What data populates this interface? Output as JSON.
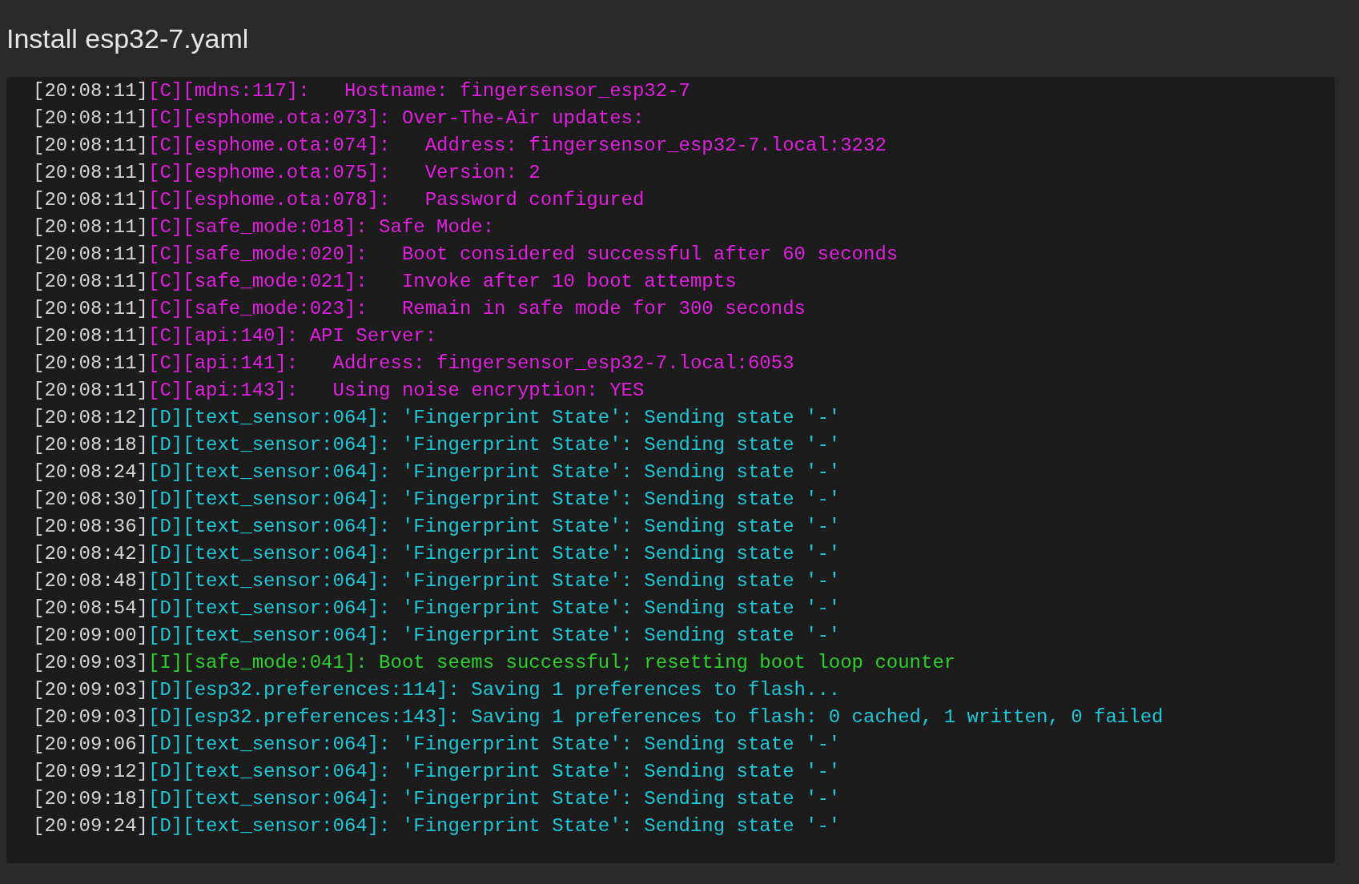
{
  "title": "Install esp32-7.yaml",
  "log_lines": [
    {
      "time": "[20:08:11]",
      "kind": "config",
      "tag": "[C]",
      "message": "[mdns:117]:   Hostname: fingersensor_esp32-7"
    },
    {
      "time": "[20:08:11]",
      "kind": "config",
      "tag": "[C]",
      "message": "[esphome.ota:073]: Over-The-Air updates:"
    },
    {
      "time": "[20:08:11]",
      "kind": "config",
      "tag": "[C]",
      "message": "[esphome.ota:074]:   Address: fingersensor_esp32-7.local:3232"
    },
    {
      "time": "[20:08:11]",
      "kind": "config",
      "tag": "[C]",
      "message": "[esphome.ota:075]:   Version: 2"
    },
    {
      "time": "[20:08:11]",
      "kind": "config",
      "tag": "[C]",
      "message": "[esphome.ota:078]:   Password configured"
    },
    {
      "time": "[20:08:11]",
      "kind": "config",
      "tag": "[C]",
      "message": "[safe_mode:018]: Safe Mode:"
    },
    {
      "time": "[20:08:11]",
      "kind": "config",
      "tag": "[C]",
      "message": "[safe_mode:020]:   Boot considered successful after 60 seconds"
    },
    {
      "time": "[20:08:11]",
      "kind": "config",
      "tag": "[C]",
      "message": "[safe_mode:021]:   Invoke after 10 boot attempts"
    },
    {
      "time": "[20:08:11]",
      "kind": "config",
      "tag": "[C]",
      "message": "[safe_mode:023]:   Remain in safe mode for 300 seconds"
    },
    {
      "time": "[20:08:11]",
      "kind": "config",
      "tag": "[C]",
      "message": "[api:140]: API Server:"
    },
    {
      "time": "[20:08:11]",
      "kind": "config",
      "tag": "[C]",
      "message": "[api:141]:   Address: fingersensor_esp32-7.local:6053"
    },
    {
      "time": "[20:08:11]",
      "kind": "config",
      "tag": "[C]",
      "message": "[api:143]:   Using noise encryption: YES"
    },
    {
      "time": "[20:08:12]",
      "kind": "debug",
      "tag": "[D]",
      "message": "[text_sensor:064]: 'Fingerprint State': Sending state '-'"
    },
    {
      "time": "[20:08:18]",
      "kind": "debug",
      "tag": "[D]",
      "message": "[text_sensor:064]: 'Fingerprint State': Sending state '-'"
    },
    {
      "time": "[20:08:24]",
      "kind": "debug",
      "tag": "[D]",
      "message": "[text_sensor:064]: 'Fingerprint State': Sending state '-'"
    },
    {
      "time": "[20:08:30]",
      "kind": "debug",
      "tag": "[D]",
      "message": "[text_sensor:064]: 'Fingerprint State': Sending state '-'"
    },
    {
      "time": "[20:08:36]",
      "kind": "debug",
      "tag": "[D]",
      "message": "[text_sensor:064]: 'Fingerprint State': Sending state '-'"
    },
    {
      "time": "[20:08:42]",
      "kind": "debug",
      "tag": "[D]",
      "message": "[text_sensor:064]: 'Fingerprint State': Sending state '-'"
    },
    {
      "time": "[20:08:48]",
      "kind": "debug",
      "tag": "[D]",
      "message": "[text_sensor:064]: 'Fingerprint State': Sending state '-'"
    },
    {
      "time": "[20:08:54]",
      "kind": "debug",
      "tag": "[D]",
      "message": "[text_sensor:064]: 'Fingerprint State': Sending state '-'"
    },
    {
      "time": "[20:09:00]",
      "kind": "debug",
      "tag": "[D]",
      "message": "[text_sensor:064]: 'Fingerprint State': Sending state '-'"
    },
    {
      "time": "[20:09:03]",
      "kind": "info",
      "tag": "[I]",
      "message": "[safe_mode:041]: Boot seems successful; resetting boot loop counter"
    },
    {
      "time": "[20:09:03]",
      "kind": "debug",
      "tag": "[D]",
      "message": "[esp32.preferences:114]: Saving 1 preferences to flash..."
    },
    {
      "time": "[20:09:03]",
      "kind": "debug",
      "tag": "[D]",
      "message": "[esp32.preferences:143]: Saving 1 preferences to flash: 0 cached, 1 written, 0 failed"
    },
    {
      "time": "[20:09:06]",
      "kind": "debug",
      "tag": "[D]",
      "message": "[text_sensor:064]: 'Fingerprint State': Sending state '-'"
    },
    {
      "time": "[20:09:12]",
      "kind": "debug",
      "tag": "[D]",
      "message": "[text_sensor:064]: 'Fingerprint State': Sending state '-'"
    },
    {
      "time": "[20:09:18]",
      "kind": "debug",
      "tag": "[D]",
      "message": "[text_sensor:064]: 'Fingerprint State': Sending state '-'"
    },
    {
      "time": "[20:09:24]",
      "kind": "debug",
      "tag": "[D]",
      "message": "[text_sensor:064]: 'Fingerprint State': Sending state '-'"
    }
  ]
}
